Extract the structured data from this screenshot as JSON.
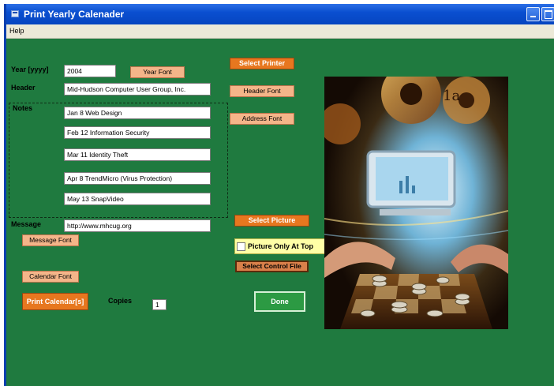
{
  "window": {
    "title": "Print Yearly Calenader"
  },
  "menu": {
    "help": "Help"
  },
  "year": {
    "label": "Year [yyyy]",
    "value": "2004",
    "font_button": "Year Font"
  },
  "header": {
    "label": "Header",
    "value": "Mid-Hudson Computer User Group, Inc.",
    "font_button": "Header Font"
  },
  "notes": {
    "label": "Notes",
    "items": [
      "Jan 8  Web Design",
      "Feb 12  Information Security",
      "Mar 11  Identity Theft",
      "Apr 8  TrendMicro (Virus Protection)",
      "May 13  SnapVideo"
    ]
  },
  "message": {
    "label": "Message",
    "value": "http://www.mhcug.org",
    "font_button": "Message Font"
  },
  "buttons": {
    "select_printer": "Select Printer",
    "address_font": "Address Font",
    "select_picture": "Select Picture",
    "select_control_file": "Select Control File",
    "calendar_font": "Calendar Font",
    "print_calendars": "Print Calendar[s]",
    "done": "Done"
  },
  "picture_only_at_top": {
    "label": "Picture Only At Top",
    "checked": false
  },
  "copies": {
    "label": "Copies",
    "value": "1"
  },
  "colors": {
    "form_bg": "#1f7a3f",
    "button_peach": "#f4b589",
    "button_orange": "#e7771f",
    "titlebar": "#0a4fd0"
  }
}
